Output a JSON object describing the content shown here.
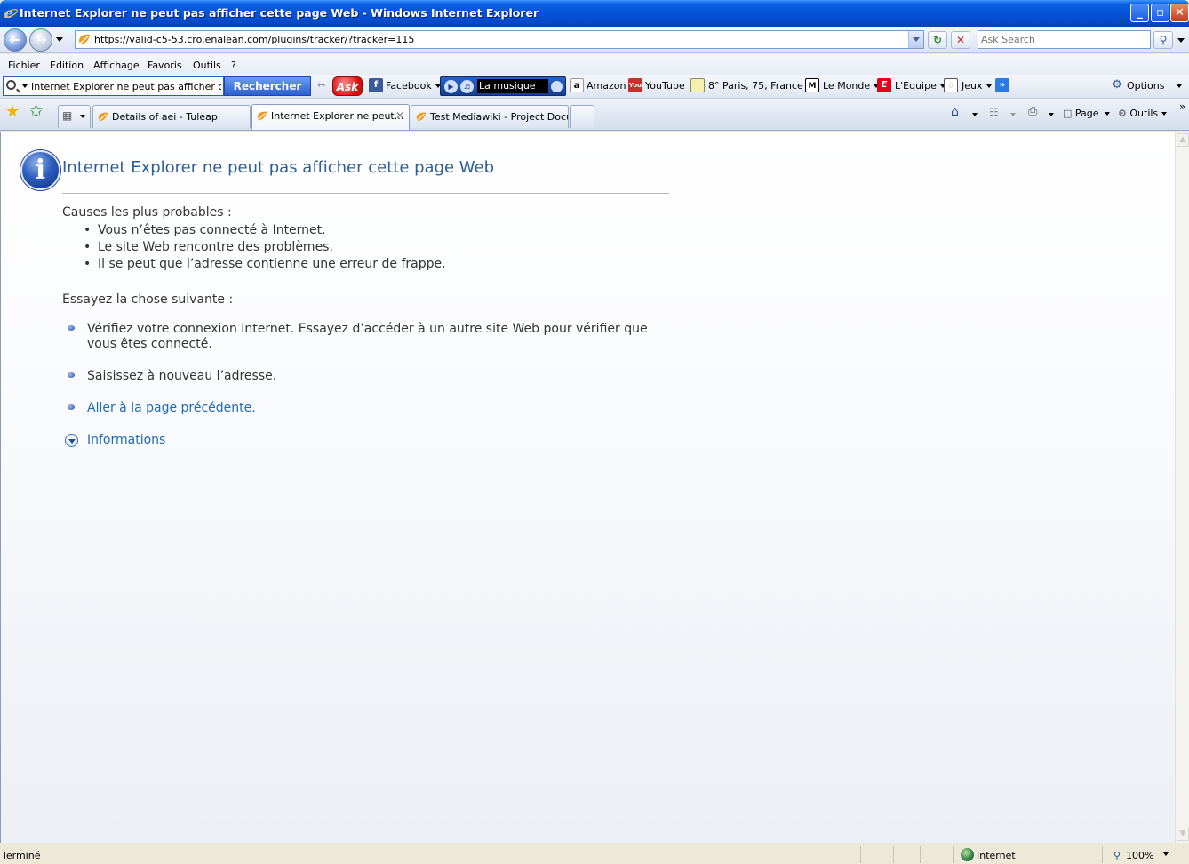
{
  "window": {
    "title": "Internet Explorer ne peut pas afficher cette page Web - Windows Internet Explorer",
    "buttons": {
      "minimize": "_",
      "maximize": "▫",
      "close": "✕"
    }
  },
  "address_bar": {
    "url": "https://valid-c5-53.cro.enalean.com/plugins/tracker/?tracker=115",
    "search_placeholder": "Ask Search"
  },
  "menu": {
    "items": [
      "Fichier",
      "Edition",
      "Affichage",
      "Favoris",
      "Outils",
      "?"
    ]
  },
  "ask_toolbar": {
    "query": "Internet Explorer ne peut pas afficher cette p",
    "search_button": "Rechercher",
    "ask_logo": "Ask",
    "facebook": "Facebook",
    "music": "La musique",
    "amazon": "Amazon",
    "youtube": "YouTube",
    "weather": "8° Paris, 75, France",
    "lemonde": "Le Monde",
    "lequipe": "L'Equipe",
    "jeux": "Jeux",
    "options": "Options"
  },
  "tabs": [
    {
      "label": "Details of aei - Tuleap",
      "active": false
    },
    {
      "label": "Internet Explorer ne peut...",
      "active": true
    },
    {
      "label": "Test Mediawiki - Project Docu...",
      "active": false
    }
  ],
  "command_bar": {
    "page": "Page",
    "tools": "Outils"
  },
  "page": {
    "title": "Internet Explorer ne peut pas afficher cette page Web",
    "causes_heading": "Causes les plus probables :",
    "causes": [
      "Vous n’êtes pas connecté à Internet.",
      "Le site Web rencontre des problèmes.",
      "Il se peut que l’adresse contienne une erreur de frappe."
    ],
    "try_heading": "Essayez la chose suivante :",
    "actions": {
      "check_line1": "Vérifiez votre connexion Internet. Essayez d’accéder à un autre site Web pour vérifier que",
      "check_line2": "vous êtes connecté.",
      "retype": "Saisissez à nouveau l’adresse.",
      "back_link": "Aller à la page précédente."
    },
    "more_info": "Informations"
  },
  "status_bar": {
    "status": "Terminé",
    "zone": "Internet",
    "zoom": "100%"
  },
  "colors": {
    "title_bar": "#0553d8",
    "page_title": "#2d5f97",
    "link": "#1f6ab4"
  }
}
